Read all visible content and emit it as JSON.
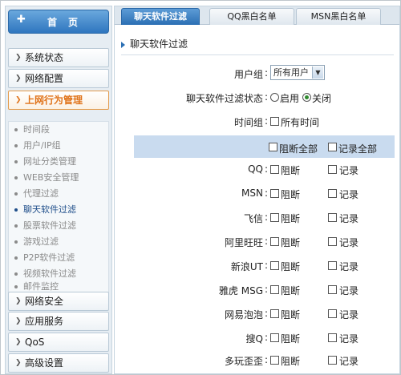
{
  "sidebar": {
    "home": {
      "icon": "plus-icon",
      "label": "首页"
    },
    "items_top": [
      {
        "label": "系统状态"
      },
      {
        "label": "网络配置"
      },
      {
        "label": "上网行为管理"
      }
    ],
    "sub_items": [
      {
        "label": "时间段"
      },
      {
        "label": "用户/IP组"
      },
      {
        "label": "网址分类管理"
      },
      {
        "label": "WEB安全管理"
      },
      {
        "label": "代理过滤"
      },
      {
        "label": "聊天软件过滤"
      },
      {
        "label": "股票软件过滤"
      },
      {
        "label": "游戏过滤"
      },
      {
        "label": "P2P软件过滤"
      },
      {
        "label": "视频软件过滤"
      },
      {
        "label": "邮件监控"
      }
    ],
    "items_bottom": [
      {
        "label": "网络安全"
      },
      {
        "label": "应用服务"
      },
      {
        "label": "QoS"
      },
      {
        "label": "高级设置"
      }
    ]
  },
  "tabs": [
    {
      "label": "聊天软件过滤"
    },
    {
      "label": "QQ黑白名单"
    },
    {
      "label": "MSN黑白名单"
    }
  ],
  "section_title": "聊天软件过滤",
  "form": {
    "user_group_label": "用户组",
    "user_group_value": "所有用户",
    "status_label": "聊天软件过滤状态",
    "enable_label": "启用",
    "disable_label": "关闭",
    "time_group_label": "时间组",
    "time_group_value": "所有时间",
    "block_all_label": "阻断全部",
    "record_all_label": "记录全部",
    "block_label": "阻断",
    "record_label": "记录",
    "colon": ":",
    "apps": [
      {
        "name": "QQ"
      },
      {
        "name": "MSN"
      },
      {
        "name": "飞信"
      },
      {
        "name": "阿里旺旺"
      },
      {
        "name": "新浪UT"
      },
      {
        "name": "雅虎 MSG"
      },
      {
        "name": "网易泡泡"
      },
      {
        "name": "搜Q"
      },
      {
        "name": "多玩歪歪"
      }
    ]
  }
}
